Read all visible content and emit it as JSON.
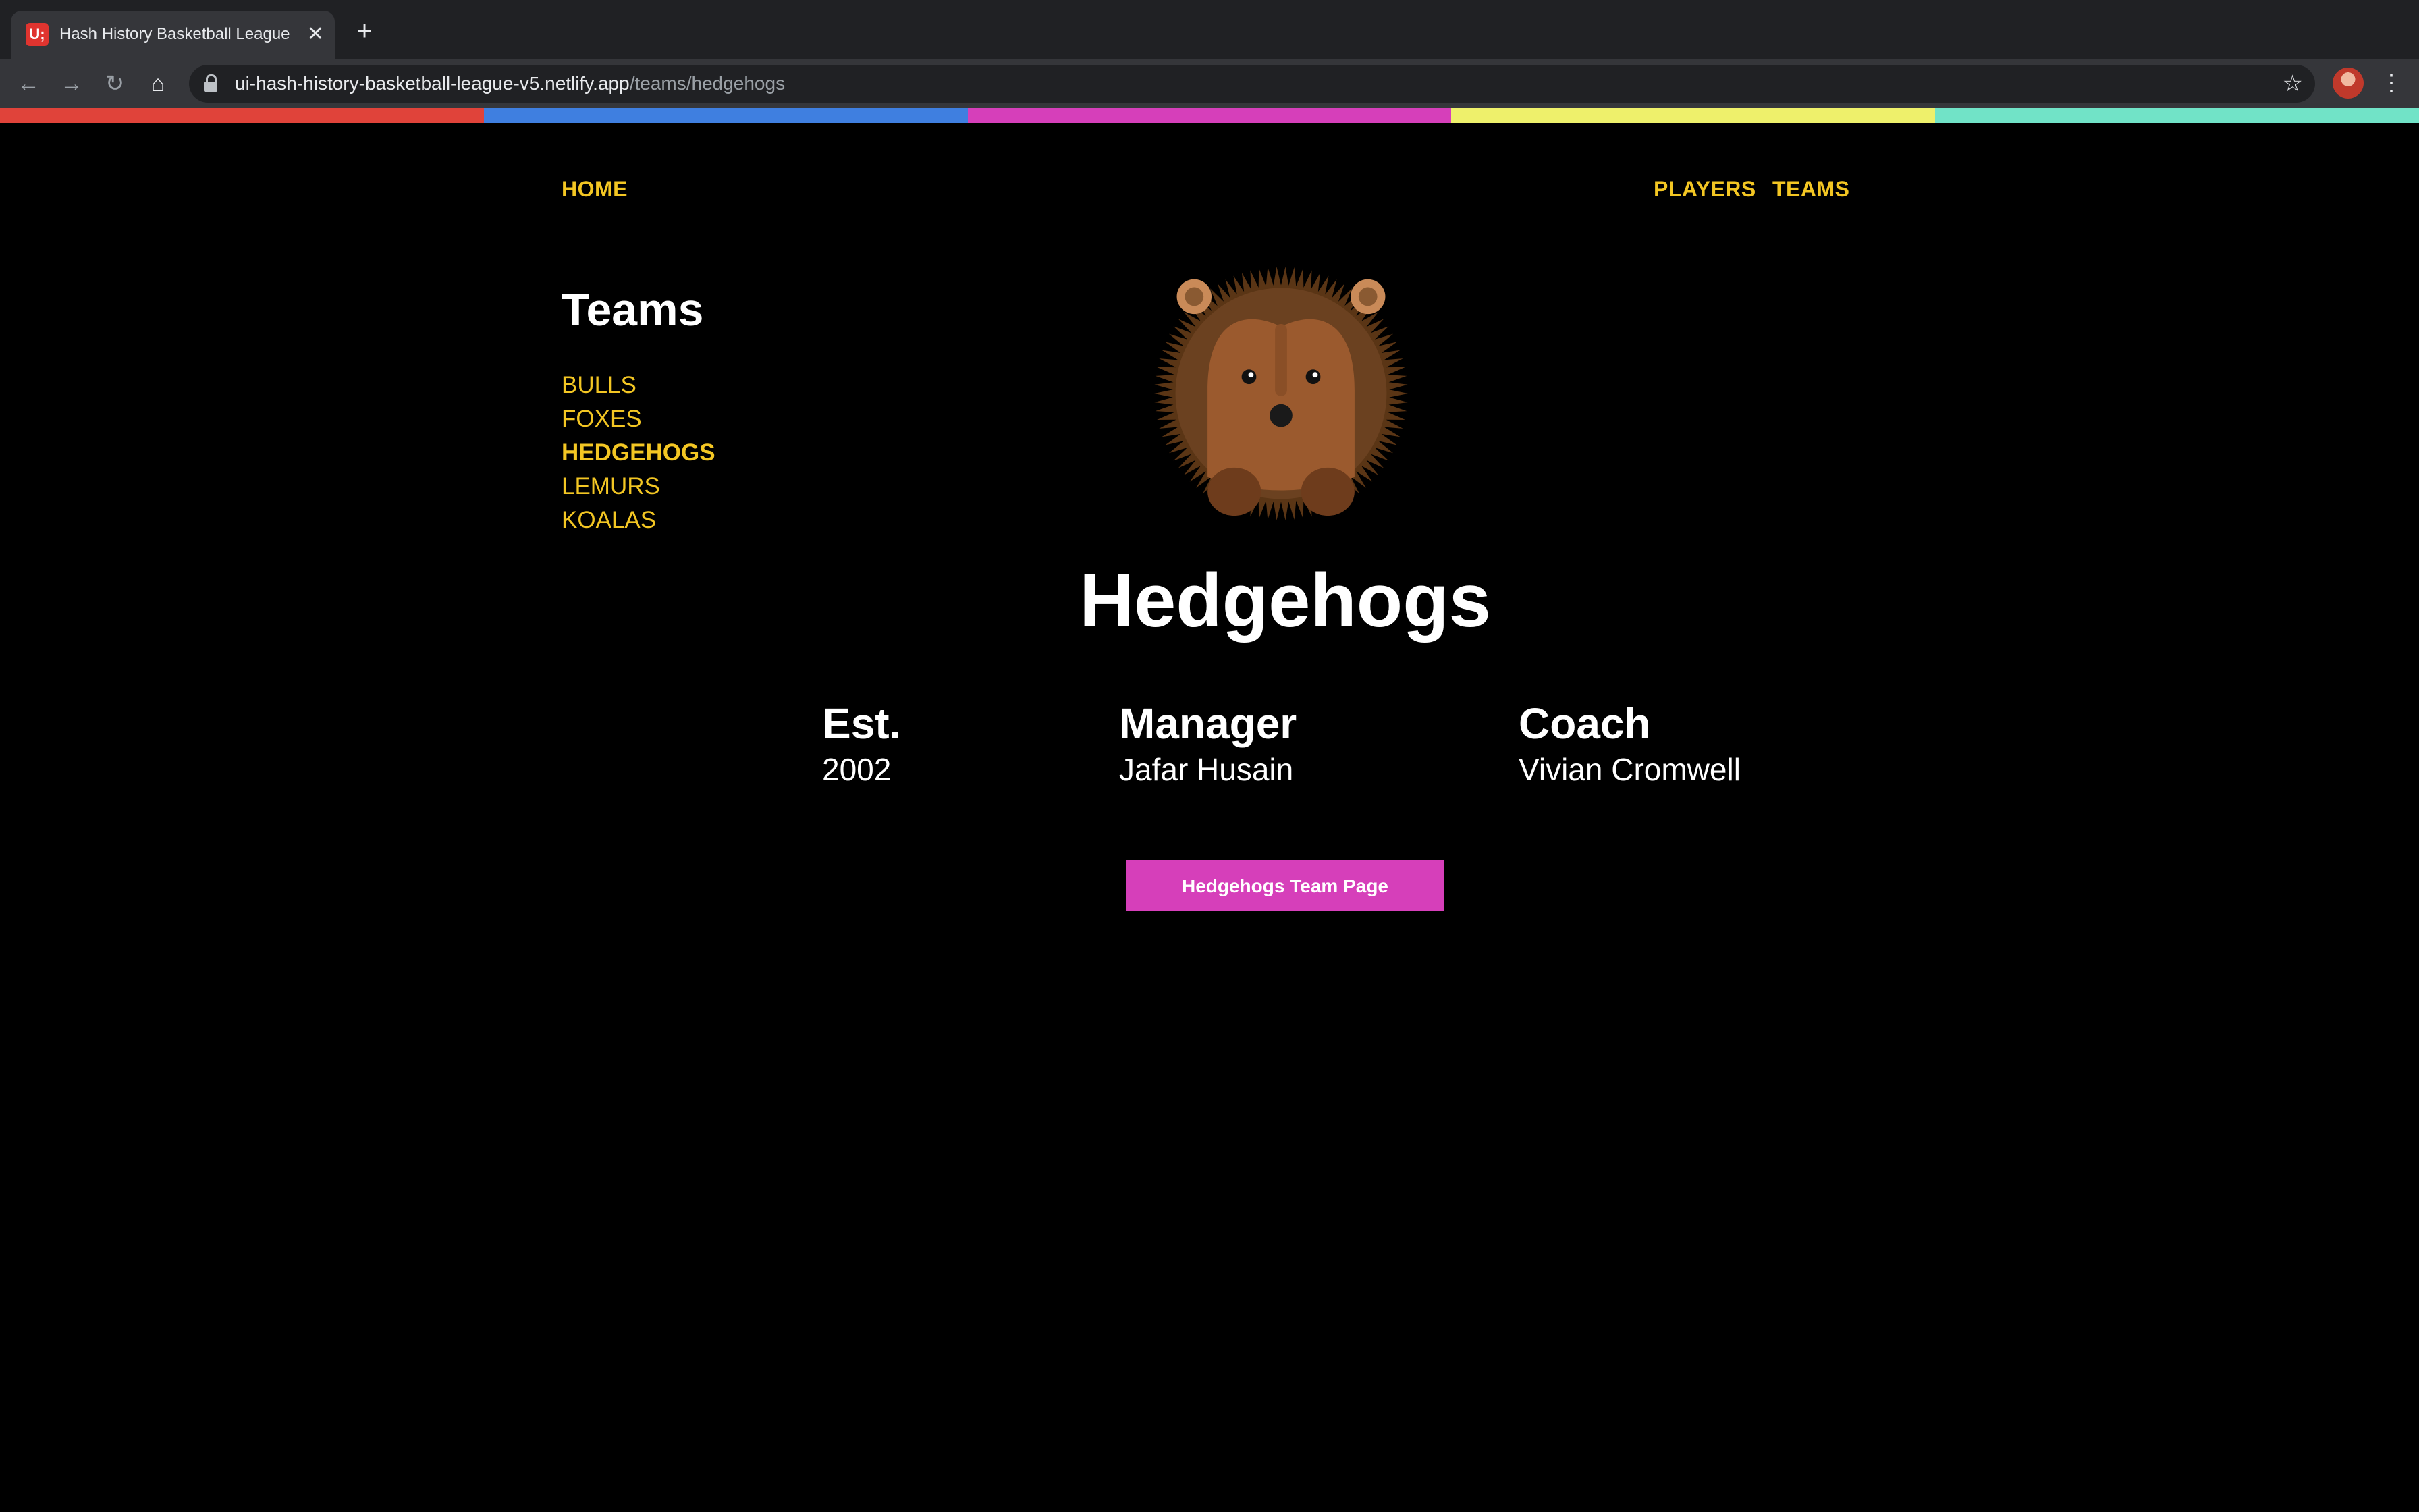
{
  "browser": {
    "tab_title": "Hash History Basketball League",
    "favicon_text": "U;",
    "url_host": "ui-hash-history-basketball-league-v5.netlify.app",
    "url_path": "/teams/hedgehogs",
    "icons": {
      "back": "back-arrow-icon",
      "forward": "forward-arrow-icon",
      "reload": "reload-icon",
      "home": "home-icon",
      "bookmark": "star-icon",
      "menu": "vertical-dots-icon"
    }
  },
  "color_strip": [
    "#e0433a",
    "#3f7fe0",
    "#d63fba",
    "#eef06b",
    "#71e3c7"
  ],
  "nav": {
    "home": "HOME",
    "players": "PLAYERS",
    "teams": "TEAMS"
  },
  "sidebar": {
    "title": "Teams",
    "items": [
      {
        "label": "BULLS",
        "active": false
      },
      {
        "label": "FOXES",
        "active": false
      },
      {
        "label": "HEDGEHOGS",
        "active": true
      },
      {
        "label": "LEMURS",
        "active": false
      },
      {
        "label": "KOALAS",
        "active": false
      }
    ]
  },
  "team": {
    "name": "Hedgehogs",
    "logo": "hedgehog-logo",
    "stats": {
      "est_label": "Est.",
      "est_value": "2002",
      "manager_label": "Manager",
      "manager_value": "Jafar Husain",
      "coach_label": "Coach",
      "coach_value": "Vivian Cromwell"
    },
    "page_button": "Hedgehogs Team Page"
  },
  "colors": {
    "accent": "#f3c623",
    "button": "#d63fba",
    "background": "#000000"
  }
}
